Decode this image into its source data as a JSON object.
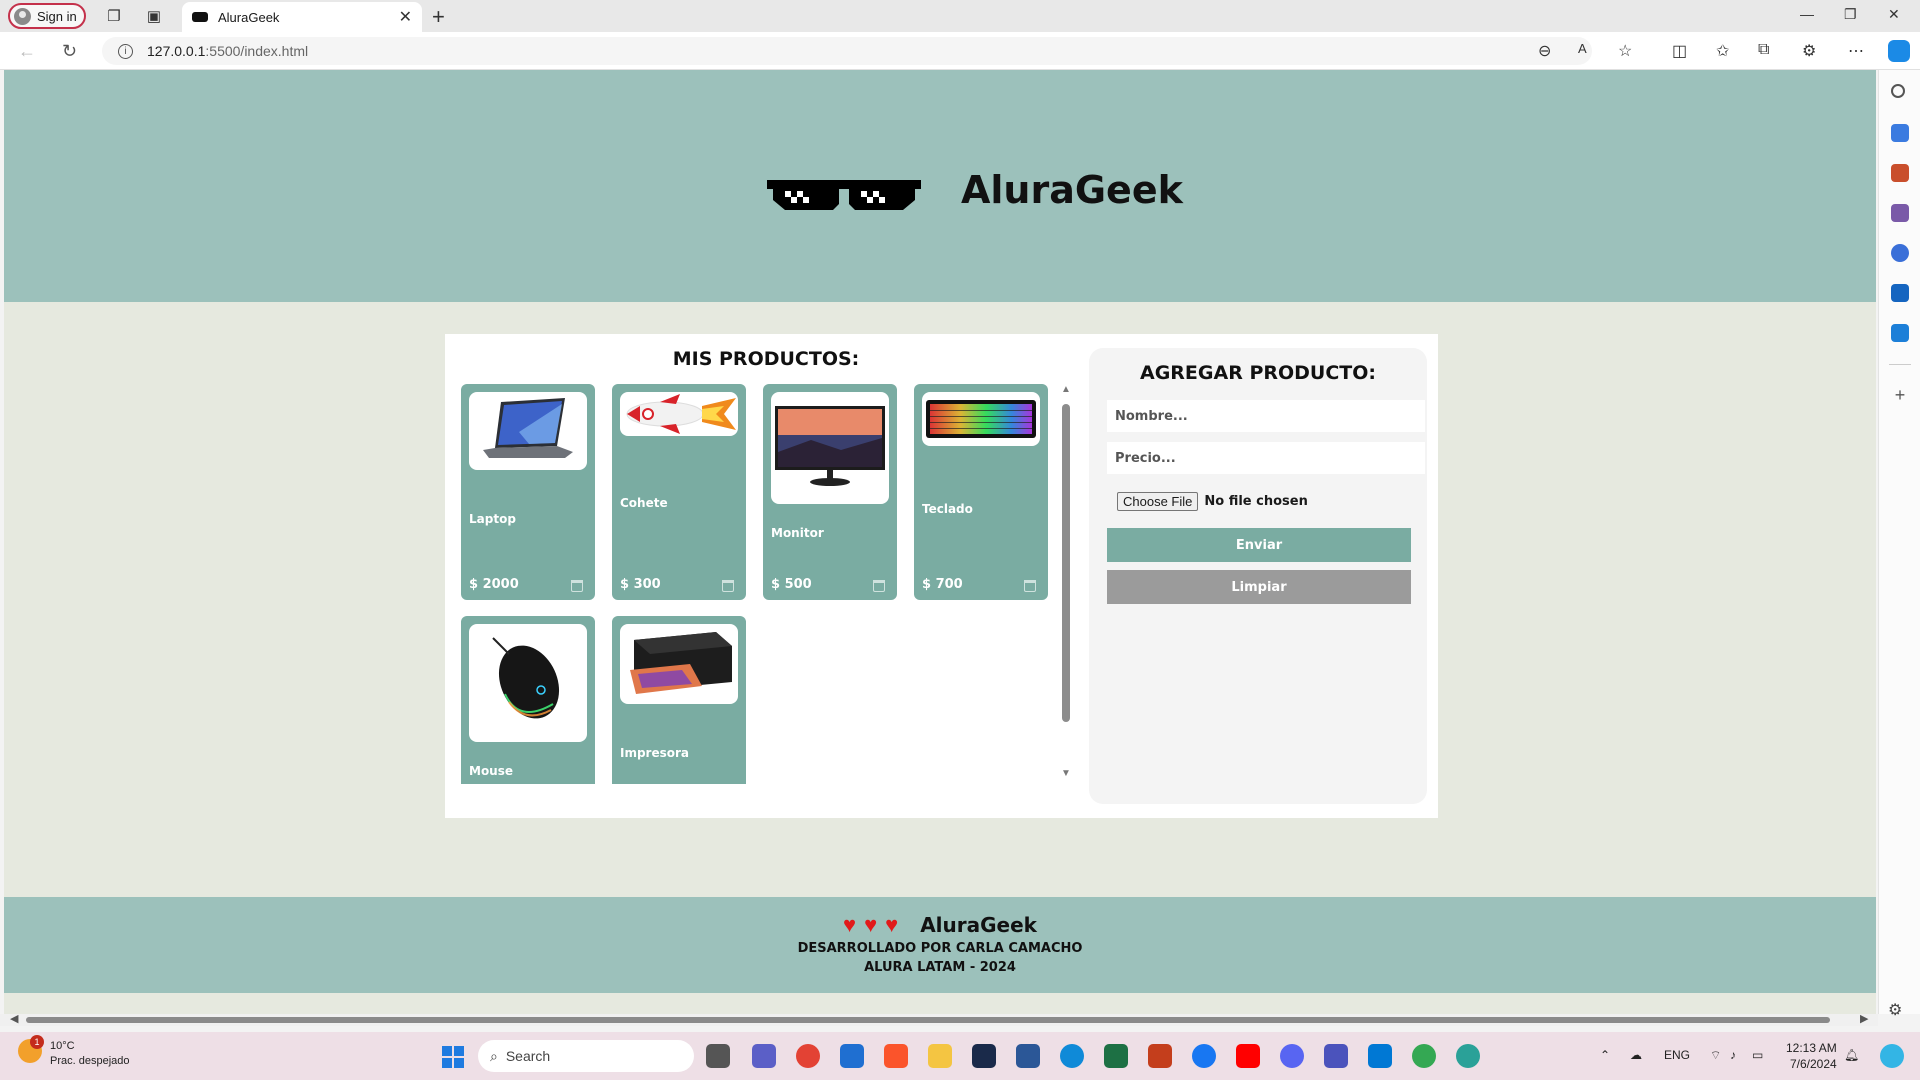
{
  "browser": {
    "signin_label": "Sign in",
    "tab_title": "AluraGeek",
    "url_host": "127.0.0.1",
    "url_path": ":5500/index.html"
  },
  "header": {
    "brand": "AluraGeek"
  },
  "products": {
    "title": "MIS PRODUCTOS:",
    "items": [
      {
        "name": "Laptop",
        "price": "$ 2000"
      },
      {
        "name": "Cohete",
        "price": "$ 300"
      },
      {
        "name": "Monitor",
        "price": "$ 500"
      },
      {
        "name": "Teclado",
        "price": "$ 700"
      },
      {
        "name": "Mouse",
        "price": ""
      },
      {
        "name": "Impresora",
        "price": ""
      }
    ]
  },
  "form": {
    "title": "AGREGAR PRODUCTO:",
    "name_placeholder": "Nombre...",
    "price_placeholder": "Precio...",
    "file_button": "Choose File",
    "file_status": "No file chosen",
    "send_label": "Enviar",
    "clear_label": "Limpiar"
  },
  "footer": {
    "brand": "AluraGeek",
    "line1": "DESARROLLADO POR CARLA CAMACHO",
    "line2": "ALURA LATAM - 2024"
  },
  "taskbar": {
    "weather_temp": "10°C",
    "weather_desc": "Prac. despejado",
    "weather_badge": "1",
    "search_label": "Search",
    "language": "ENG",
    "time": "12:13 AM",
    "date": "7/6/2024"
  },
  "colors": {
    "header_bg": "#9cc1bb",
    "card_bg": "#7aaca2",
    "page_bg": "#e6e9df",
    "clear_button": "#9b9b9b"
  }
}
